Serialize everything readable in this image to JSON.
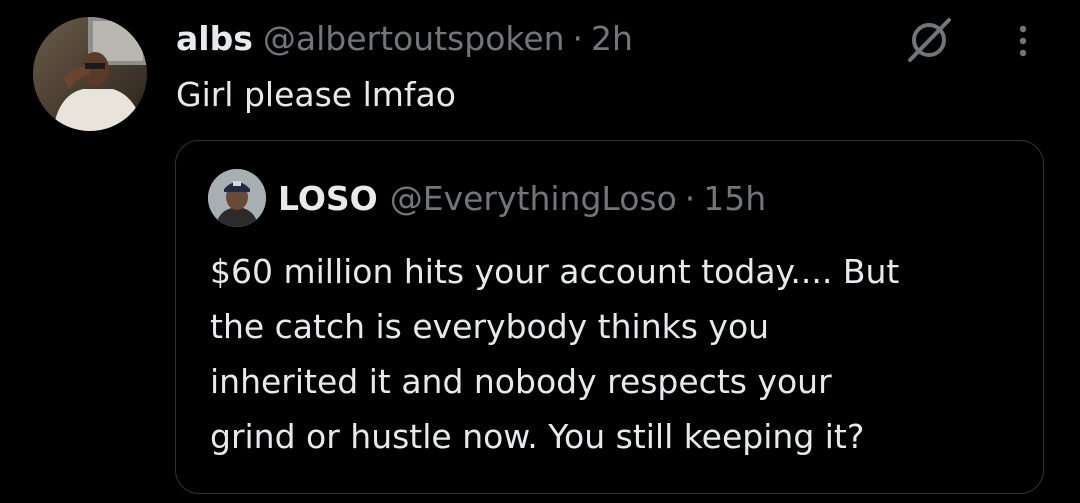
{
  "post": {
    "display_name": "albs",
    "handle": "@albertoutspoken",
    "separator": "·",
    "time": "2h",
    "text": "Girl please lmfao",
    "avatar_icon": "profile-photo",
    "actions": {
      "grok_icon": "grok-icon",
      "more_icon": "more-vertical-icon"
    }
  },
  "quote": {
    "display_name": "LOSO",
    "handle": "@EverythingLoso",
    "separator": "·",
    "time": "15h",
    "text_lines": [
      "$60 million hits your account today.... But",
      "the catch is everybody thinks you",
      "inherited it and nobody respects your",
      "grind or hustle now. You still keeping it?"
    ],
    "avatar_icon": "profile-photo"
  },
  "colors": {
    "background": "#000000",
    "primary_text": "#e7e9ea",
    "secondary_text": "#71767b",
    "border": "#2f3336"
  }
}
